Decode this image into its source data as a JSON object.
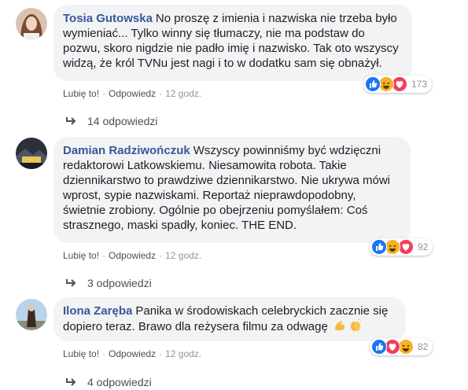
{
  "comments": [
    {
      "author": "Tosia Gutowska",
      "text": "No proszę z imienia i nazwiska nie trzeba było wymieniać... Tylko winny się tłumaczy, nie ma podstaw do pozwu, skoro nigdzie nie padło imię i nazwisko. Tak oto wszyscy widzą, że król TVNu jest nagi i to w dodatku sam się obnażył.",
      "like_label": "Lubię to!",
      "reply_label": "Odpowiedz",
      "time": "12 godz.",
      "reaction_count": "173",
      "reactions": [
        "like-icon",
        "haha-icon",
        "love-icon"
      ],
      "replies_label": "14 odpowiedzi"
    },
    {
      "author": "Damian Radziwończuk",
      "text": "Wszyscy powinniśmy być wdzięczni redaktorowi Latkowskiemu. Niesamowita robota. Takie dziennikarstwo to prawdziwe dziennikarstwo. Nie ukrywa mówi wprost, sypie nazwiskami. Reportaż nieprawdopodobny, świetnie zrobiony. Ogólnie po obejrzeniu pomyślałem: Coś strasznego, maski spadły, koniec. THE END.",
      "like_label": "Lubię to!",
      "reply_label": "Odpowiedz",
      "time": "12 godz.",
      "reaction_count": "92",
      "reactions": [
        "like-icon",
        "haha-icon",
        "love-icon"
      ],
      "replies_label": "3 odpowiedzi"
    },
    {
      "author": "Ilona Zaręba",
      "text": "Panika w środowiskach celebryckich zacznie się dopiero teraz. Brawo dla reżysera filmu za odwagę",
      "like_label": "Lubię to!",
      "reply_label": "Odpowiedz",
      "time": "12 godz.",
      "reaction_count": "82",
      "reactions": [
        "like-icon",
        "love-icon",
        "haha-icon"
      ],
      "inline_emojis": [
        "flexed-biceps-icon",
        "clapping-hands-icon"
      ],
      "replies_label": "4 odpowiedzi"
    }
  ],
  "colors": {
    "author": "#385898",
    "bubble": "#f2f3f5",
    "like": "#1877f2",
    "love": "#f33e58",
    "haha": "#f7b125"
  }
}
